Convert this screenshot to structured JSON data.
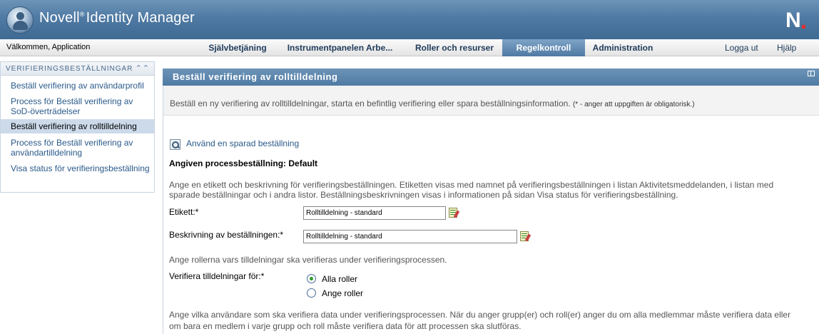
{
  "header": {
    "brand": "Novell",
    "reg": "®",
    "product": "Identity Manager",
    "logo_letter": "N"
  },
  "nav": {
    "welcome": "Välkommen, Application",
    "tabs": [
      {
        "label": "Självbetjäning"
      },
      {
        "label": "Instrumentpanelen Arbe..."
      },
      {
        "label": "Roller och resurser"
      },
      {
        "label": "Regelkontroll"
      },
      {
        "label": "Administration"
      }
    ],
    "active_tab": "Regelkontroll",
    "logout": "Logga ut",
    "help": "Hjälp"
  },
  "sidebar": {
    "title": "VERIFIERINGSBESTÄLLNINGAR",
    "collapse_glyph": "≈",
    "items": [
      {
        "label": "Beställ verifiering av användarprofil"
      },
      {
        "label": "Process för Beställ verifiering av SoD-överträdelser"
      },
      {
        "label": "Beställ verifiering av rolltilldelning"
      },
      {
        "label": "Process för Beställ verifiering av användartilldelning"
      },
      {
        "label": "Visa status för verifieringsbeställning"
      }
    ],
    "selected_index": 2
  },
  "panel": {
    "title": "Beställ verifiering av rolltilldelning",
    "description": "Beställ en ny verifiering av rolltilldelningar, starta en befintlig verifiering eller spara beställningsinformation.",
    "required_note": "(* - anger att uppgiften är obligatorisk.)",
    "saved_link": "Använd en sparad beställning",
    "process_label": "Angiven processbeställning: Default",
    "intro_line1": "Ange en etikett och beskrivning för verifieringsbeställningen. Etiketten visas med namnet på verifieringsbeställningen i listan Aktivitetsmeddelanden, i listan med",
    "intro_line2": "sparade beställningar och i andra listor. Beställningsbeskrivningen visas i informationen på sidan Visa status för verifieringsbeställning.",
    "label_field": {
      "label": "Etikett:*",
      "value": "Rolltilldelning - standard"
    },
    "desc_field": {
      "label": "Beskrivning av beställningen:*",
      "value": "Rolltilldelning - standard"
    },
    "roles_intro": "Ange rollerna vars tilldelningar ska verifieras under verifieringsprocessen.",
    "verify_label": "Verifiera tilldelningar för:*",
    "radio_all": "Alla roller",
    "radio_specific": "Ange roller",
    "users_line1": "Ange vilka användare som ska verifiera data under verifieringsprocessen. När du anger grupp(er) och roll(er) anger du om alla medlemmar måste verifiera data eller",
    "users_line2": "om bara en medlem i varje grupp och roll måste verifiera data för att processen ska slutföras."
  },
  "colors": {
    "header_blue": "#4f7aa3",
    "link_blue": "#2a5a8a",
    "selected_bg": "#ccdaea"
  }
}
